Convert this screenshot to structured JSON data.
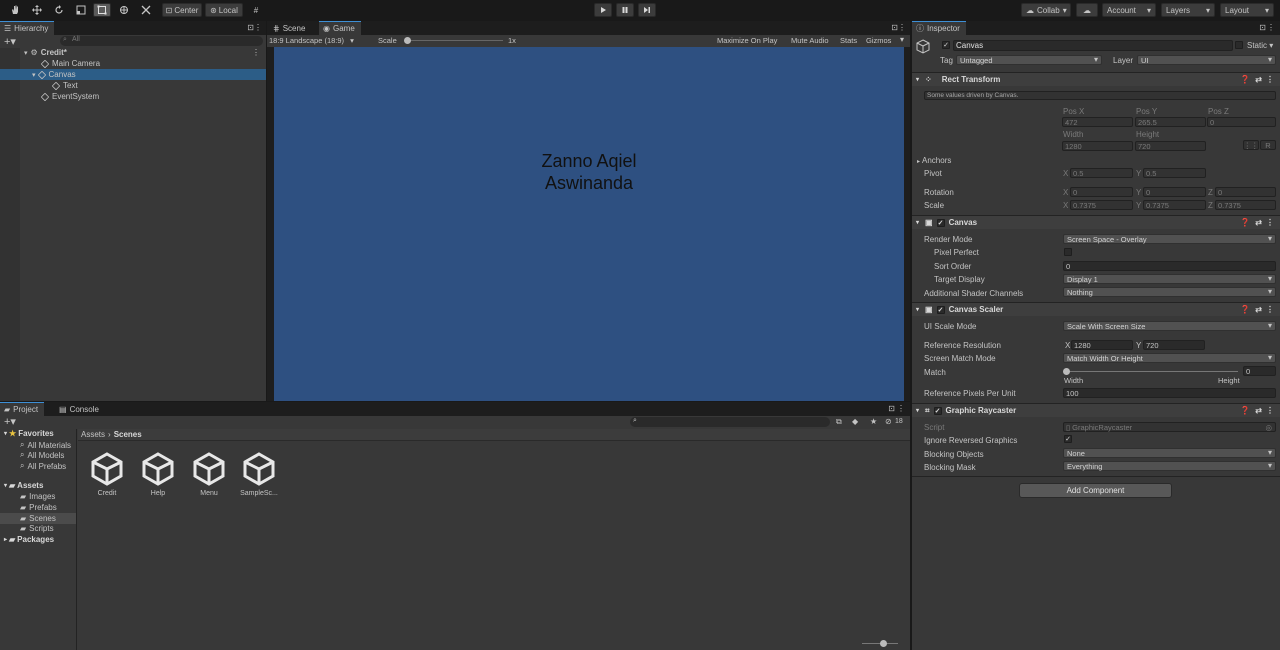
{
  "toolbar": {
    "tools": [
      "hand-tool",
      "move-tool",
      "rotate-tool",
      "scale-tool",
      "rect-tool",
      "transform-tool",
      "custom-tool"
    ],
    "pivot": "Center",
    "space": "Local",
    "collab": "Collab",
    "account": "Account",
    "layers": "Layers",
    "layout": "Layout"
  },
  "hierarchy": {
    "tab": "Hierarchy",
    "search_placeholder": "All",
    "items": [
      {
        "label": "Credit*"
      },
      {
        "label": "Main Camera"
      },
      {
        "label": "Canvas"
      },
      {
        "label": "Text"
      },
      {
        "label": "EventSystem"
      }
    ]
  },
  "sceneview": {
    "tabs": [
      "Scene",
      "Game"
    ],
    "resolution": "18:9 Landscape (18:9)",
    "scale_label": "Scale",
    "scale_value": "1x",
    "maximize": "Maximize On Play",
    "mute": "Mute Audio",
    "stats": "Stats",
    "gizmos": "Gizmos",
    "canvas_text_line1": "Zanno Aqiel",
    "canvas_text_line2": "Aswinanda"
  },
  "project": {
    "tabs": [
      "Project",
      "Console"
    ],
    "breadcrumb": [
      "Assets",
      "Scenes"
    ],
    "hidden_count": "18",
    "tree": [
      {
        "label": "Favorites"
      },
      {
        "label": "All Materials"
      },
      {
        "label": "All Models"
      },
      {
        "label": "All Prefabs"
      },
      {
        "label": "Assets"
      },
      {
        "label": "Images"
      },
      {
        "label": "Prefabs"
      },
      {
        "label": "Scenes"
      },
      {
        "label": "Scripts"
      },
      {
        "label": "Packages"
      }
    ],
    "assets": [
      {
        "label": "Credit"
      },
      {
        "label": "Help"
      },
      {
        "label": "Menu"
      },
      {
        "label": "SampleSc..."
      }
    ]
  },
  "inspector": {
    "tab": "Inspector",
    "object_name": "Canvas",
    "static_label": "Static",
    "tag_label": "Tag",
    "tag_value": "Untagged",
    "layer_label": "Layer",
    "layer_value": "UI",
    "rect_transform": {
      "title": "Rect Transform",
      "note": "Some values driven by Canvas.",
      "pos_x_label": "Pos X",
      "pos_x": "472",
      "pos_y_label": "Pos Y",
      "pos_y": "265.5",
      "pos_z_label": "Pos Z",
      "pos_z": "0",
      "width_label": "Width",
      "width": "1280",
      "height_label": "Height",
      "height": "720",
      "r_btn": "R",
      "anchors": "Anchors",
      "pivot_label": "Pivot",
      "pivot_x": "0.5",
      "pivot_y": "0.5",
      "rotation_label": "Rotation",
      "rot_x": "0",
      "rot_y": "0",
      "rot_z": "0",
      "scale_label": "Scale",
      "scale_x": "0.7375",
      "scale_y": "0.7375",
      "scale_z": "0.7375",
      "x": "X",
      "y": "Y",
      "z": "Z"
    },
    "canvas": {
      "title": "Canvas",
      "render_mode_label": "Render Mode",
      "render_mode": "Screen Space - Overlay",
      "pixel_perfect_label": "Pixel Perfect",
      "sort_order_label": "Sort Order",
      "sort_order": "0",
      "target_display_label": "Target Display",
      "target_display": "Display 1",
      "shader_channels_label": "Additional Shader Channels",
      "shader_channels": "Nothing"
    },
    "canvas_scaler": {
      "title": "Canvas Scaler",
      "ui_scale_mode_label": "UI Scale Mode",
      "ui_scale_mode": "Scale With Screen Size",
      "ref_res_label": "Reference Resolution",
      "ref_x": "1280",
      "ref_y": "720",
      "match_mode_label": "Screen Match Mode",
      "match_mode": "Match Width Or Height",
      "match_label": "Match",
      "match_value": "0",
      "match_fraction": 0,
      "width_label": "Width",
      "height_label": "Height",
      "ref_ppu_label": "Reference Pixels Per Unit",
      "ref_ppu": "100"
    },
    "graphic_raycaster": {
      "title": "Graphic Raycaster",
      "script_label": "Script",
      "script": "GraphicRaycaster",
      "ignore_reversed_label": "Ignore Reversed Graphics",
      "blocking_objects_label": "Blocking Objects",
      "blocking_objects": "None",
      "blocking_mask_label": "Blocking Mask",
      "blocking_mask": "Everything"
    },
    "add_component": "Add Component"
  },
  "colors": {
    "selection": "#2c5d87",
    "game_bg": "#2e5081",
    "panel": "#383838",
    "accent": "#3d8fd6"
  }
}
